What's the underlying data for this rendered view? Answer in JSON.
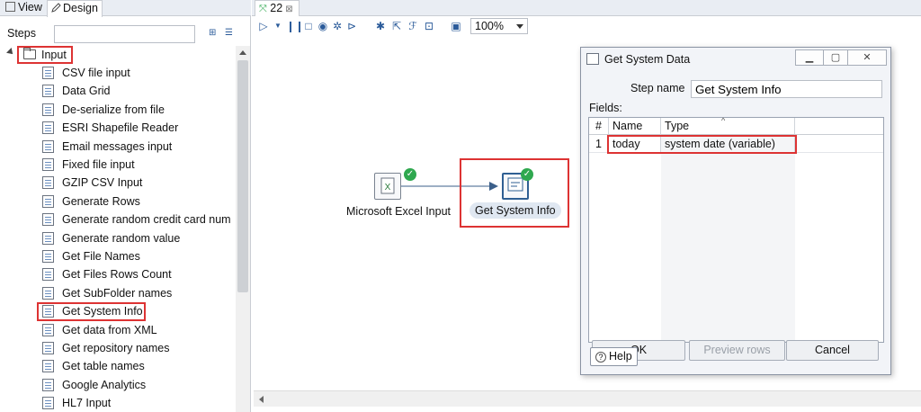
{
  "left_panel": {
    "tabs": [
      "View",
      "Design"
    ],
    "steps_label": "Steps",
    "filter_placeholder": "",
    "category": "Input",
    "items": [
      "CSV file input",
      "Data Grid",
      "De-serialize from file",
      "ESRI Shapefile Reader",
      "Email messages input",
      "Fixed file input",
      "GZIP CSV Input",
      "Generate Rows",
      "Generate random credit card num",
      "Generate random value",
      "Get File Names",
      "Get Files Rows Count",
      "Get SubFolder names",
      "Get System Info",
      "Get data from XML",
      "Get repository names",
      "Get table names",
      "Google Analytics",
      "HL7 Input"
    ]
  },
  "editor": {
    "tab_label": "22",
    "zoom": "100%",
    "steps": [
      {
        "label": "Microsoft Excel Input"
      },
      {
        "label": "Get System Info"
      }
    ]
  },
  "dialog": {
    "title": "Get System Data",
    "step_name_label": "Step name",
    "step_name_value": "Get System Info",
    "fields_label": "Fields:",
    "columns": [
      "#",
      "Name",
      "Type"
    ],
    "rows": [
      {
        "num": "1",
        "name": "today",
        "type": "system date (variable)"
      }
    ],
    "ok_label": "OK",
    "preview_label": "Preview rows",
    "cancel_label": "Cancel",
    "help_label": "Help"
  },
  "colors": {
    "highlight": "#dd3333",
    "accent": "#2f5f93",
    "ok_badge": "#2fa84f"
  }
}
